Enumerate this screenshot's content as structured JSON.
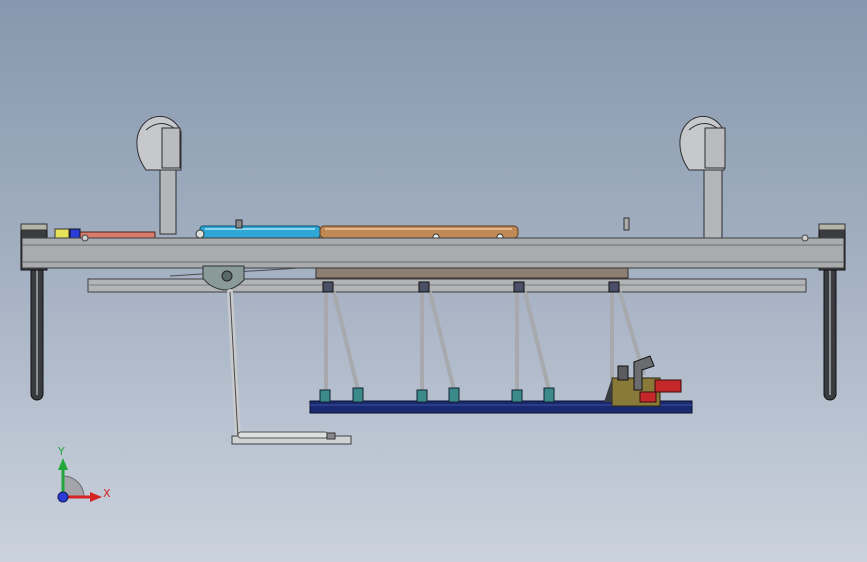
{
  "triad": {
    "x_label": "X",
    "y_label": "Y",
    "x_color": "#d42424",
    "y_color": "#22a83a",
    "z_color": "#2b3bd6"
  },
  "colors": {
    "background_top": "#8797ad",
    "background_bottom": "#cbd2dd",
    "frame": "#a9abad",
    "frame_edge": "#3c3e42",
    "copper_rod": "#c08a56",
    "cyan_rod": "#2fa7d6",
    "red_rod": "#d97a6a",
    "track_blue": "#1a2a6e",
    "teal_block": "#3c8a8a",
    "olive_part": "#8a7a3a",
    "red_part": "#c4282a",
    "dark_post": "#2e2f33",
    "grey_plate": "#8d7f73"
  }
}
